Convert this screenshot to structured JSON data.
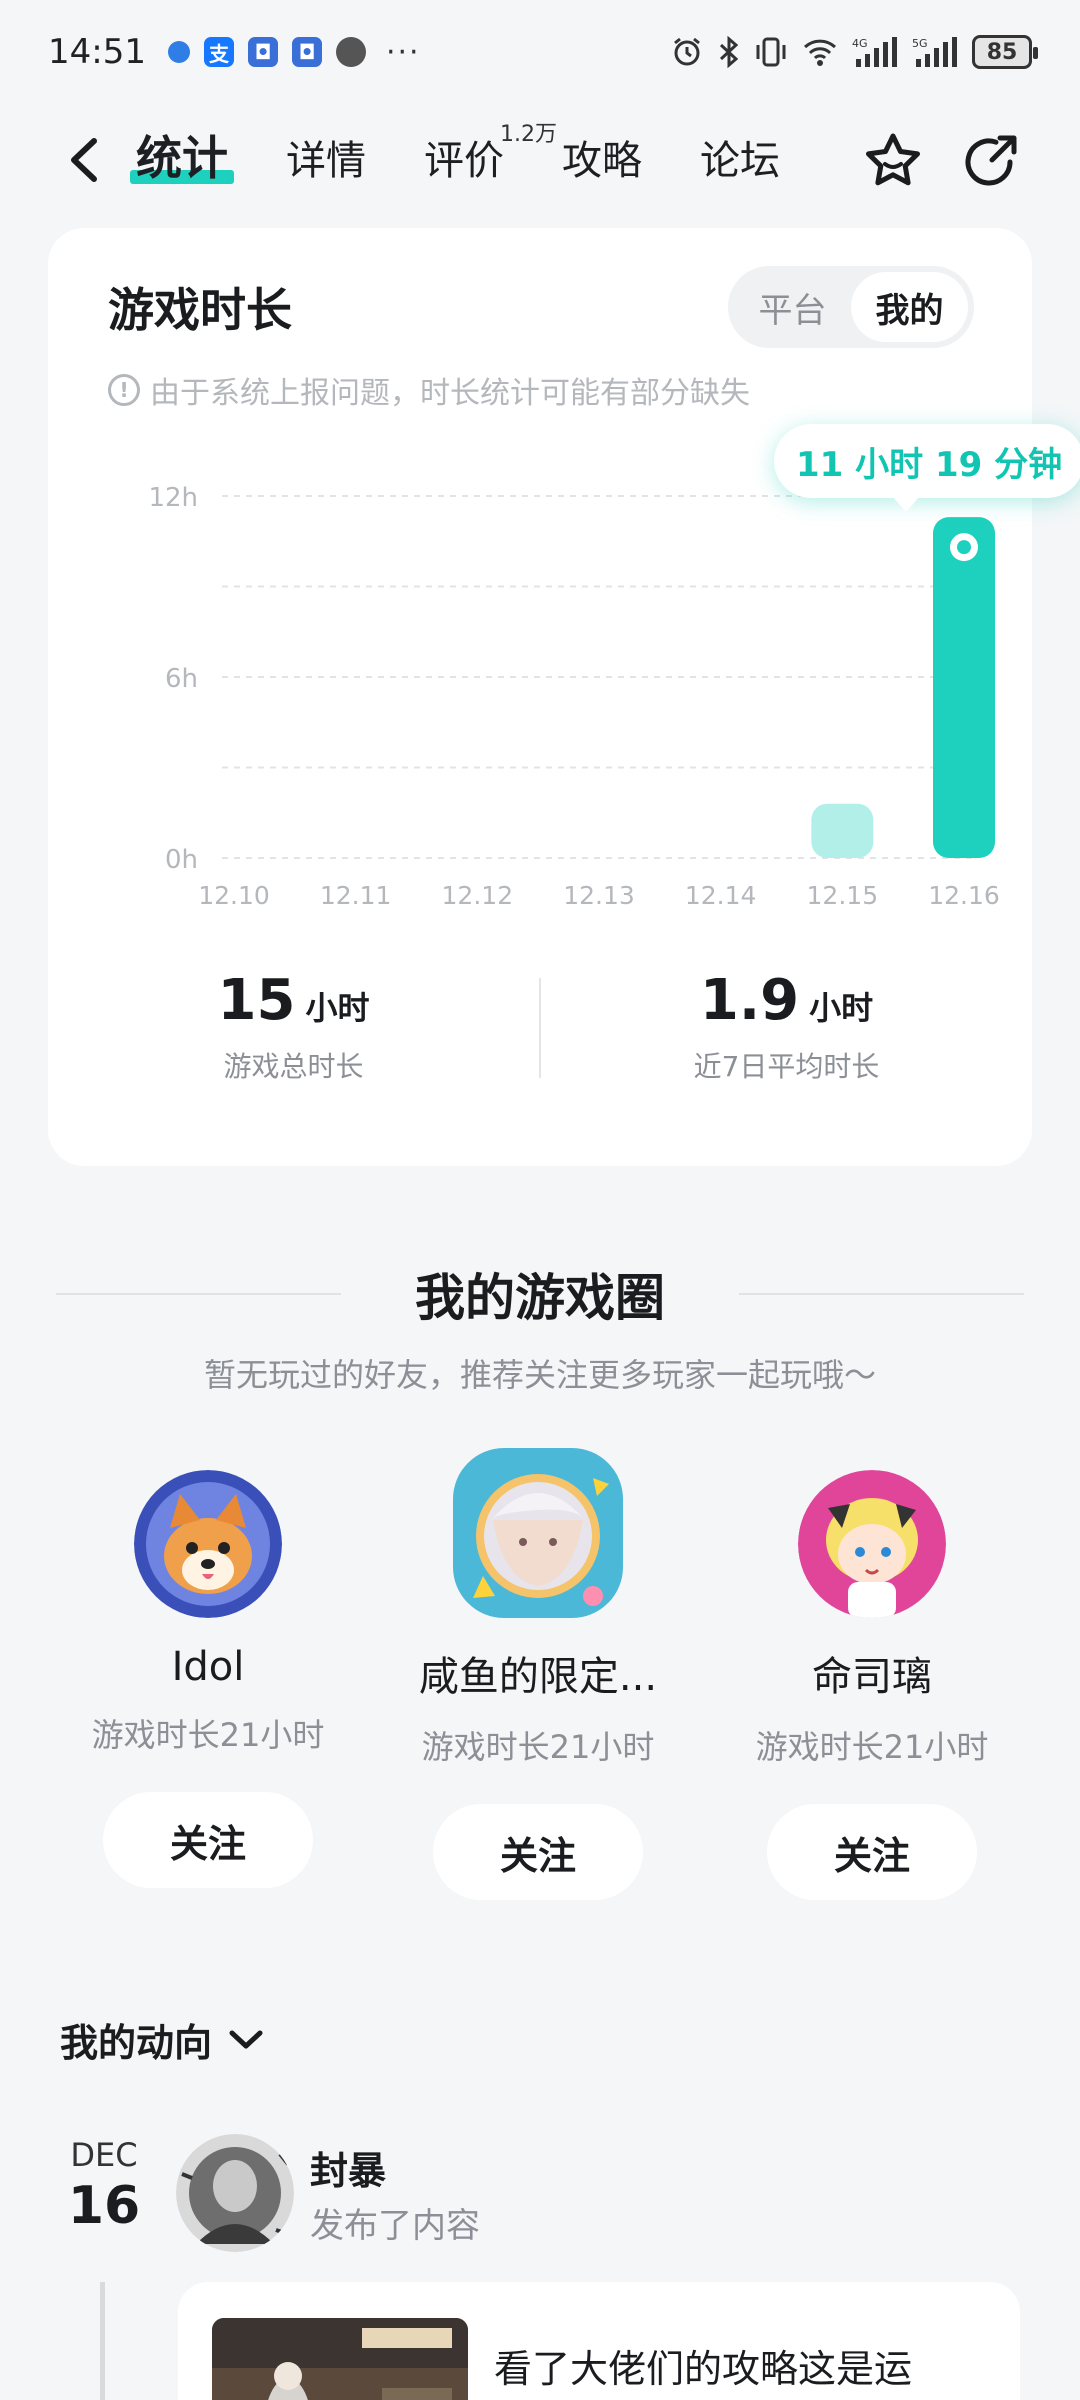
{
  "status_bar": {
    "time": "14:51",
    "battery": "85",
    "signal1": "4G",
    "signal2": "5G",
    "app_icons": [
      "pin-icon",
      "alipay-icon",
      "app-icon",
      "app-icon",
      "chat-icon"
    ]
  },
  "nav": {
    "tabs": [
      "统计",
      "详情",
      "评价",
      "攻略",
      "论坛"
    ],
    "active_tab": "统计",
    "review_badge": "1.2万"
  },
  "stats": {
    "title": "游戏时长",
    "toggle": [
      "平台",
      "我的"
    ],
    "toggle_active": "我的",
    "notice": "由于系统上报问题，时长统计可能有部分缺失",
    "tooltip": "11 小时 19 分钟",
    "total_value": "15",
    "total_unit": "小时",
    "total_label": "游戏总时长",
    "avg_value": "1.9",
    "avg_unit": "小时",
    "avg_label": "近7日平均时长"
  },
  "chart_data": {
    "type": "bar",
    "categories": [
      "12.10",
      "12.11",
      "12.12",
      "12.13",
      "12.14",
      "12.15",
      "12.16"
    ],
    "values": [
      0,
      0,
      0,
      0,
      0,
      1.8,
      11.3
    ],
    "y_ticks": [
      "0h",
      "6h",
      "12h"
    ],
    "ylim": [
      0,
      12
    ],
    "grid": true,
    "highlight_index": 6,
    "colors": {
      "highlight": "#1ed1be",
      "normal": "#b2efe9"
    }
  },
  "circle": {
    "title": "我的游戏圈",
    "subtitle": "暂无玩过的好友，推荐关注更多玩家一起玩哦～",
    "players": [
      {
        "name": "Idol",
        "meta": "游戏时长21小时",
        "follow": "关注"
      },
      {
        "name": "咸鱼的限定...",
        "meta": "游戏时长21小时",
        "follow": "关注"
      },
      {
        "name": "命司璃",
        "meta": "游戏时长21小时",
        "follow": "关注"
      }
    ]
  },
  "activity": {
    "title": "我的动向",
    "date_month": "DEC",
    "date_day": "16",
    "user": "封暴",
    "action": "发布了内容",
    "post_text": "看了大佬们的攻略这是运"
  }
}
